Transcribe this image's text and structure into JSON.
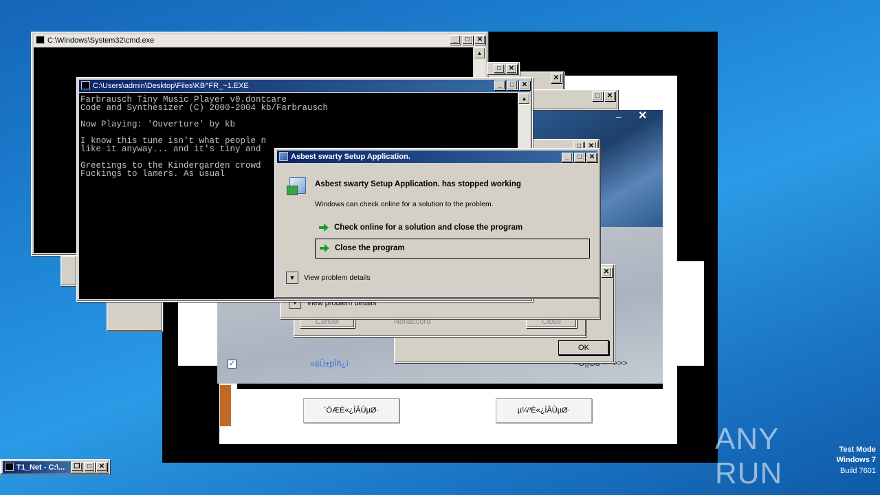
{
  "cmd_window": {
    "title": "C:\\Windows\\System32\\cmd.exe"
  },
  "player_window": {
    "title": "C:\\Users\\admin\\Desktop\\Files\\KB^FR_~1.EXE",
    "lines": [
      "Farbrausch Tiny Music Player v0.dontcare",
      "Code and Synthesizer (C) 2000-2004 kb/Farbrausch",
      "",
      "Now Playing: 'Ouverture' by kb",
      "",
      "I know this tune isn't what people n",
      "like it anyway... and it's tiny and ",
      "",
      "Greetings to the Kindergarden crowd",
      "Fuckings to lamers. As usual"
    ]
  },
  "error_dialog": {
    "title": "Asbest swarty Setup Application.",
    "heading": "Asbest swarty Setup Application. has stopped working",
    "message": "Windows can check online for a solution to the problem.",
    "option_check": "Check online for a solution and close the program",
    "option_close": "Close the program",
    "details": "View problem details"
  },
  "back_dialog": {
    "details": "View problem details",
    "cancel": "Cancel",
    "middle": "Nonaccord",
    "close": "Close"
  },
  "ok_dialog": {
    "ok": "OK"
  },
  "installer": {
    "garbled_link": "»äÛ±þÎñ¿ì",
    "garbled_right": "×Ö||Öd²×° >>>",
    "button_left": "´ÖÆÈ«¿ÌÂÛµØ·",
    "button_right": "µ¼ºÈ«¿ÌÂÛµØ·"
  },
  "taskbar_item": {
    "label": "T1_Net - C:\\..."
  },
  "watermark": {
    "text": "ANY RUN",
    "line1": "Test Mode",
    "line2": "Windows 7",
    "line3": "Build 7601"
  },
  "colors": {
    "titlebar_active": "#0a246a",
    "dialog_face": "#d4d0c8",
    "arrow_green": "#1c9e27"
  }
}
